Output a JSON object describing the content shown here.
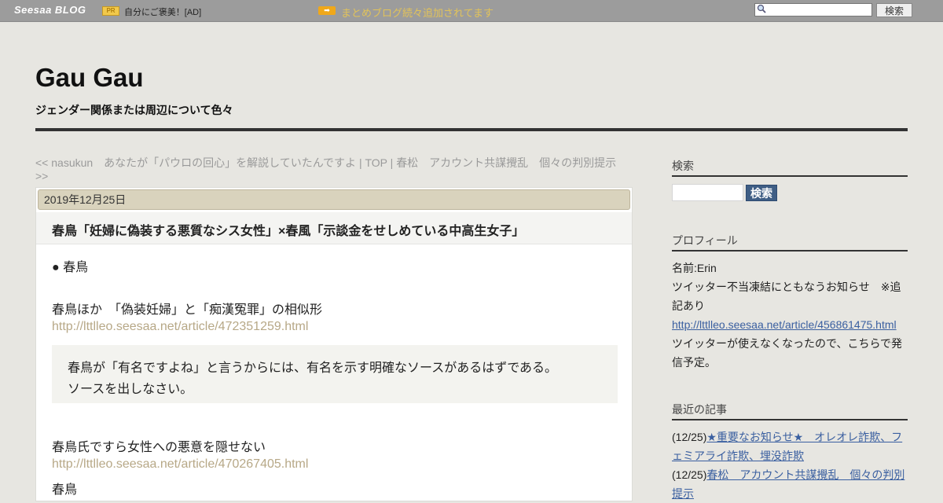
{
  "topbar": {
    "logo": "Seesaa BLOG",
    "pr_badge": "PR",
    "pr_text": "自分にご褒美！[AD]",
    "arrow_badge": "➡",
    "notice": "まとめブログ続々追加されてます",
    "search_button": "検索"
  },
  "header": {
    "title": "Gau Gau",
    "description": "ジェンダー関係または周辺について色々"
  },
  "nav": {
    "prev": "<< nasukun　あなたが「パウロの回心」を解説していたんですよ",
    "sep1": " | ",
    "top": "TOP",
    "sep2": " | ",
    "next": "春松　アカウント共謀攪乱　個々の判別提示",
    "next_arrow": ">>"
  },
  "article": {
    "date": "2019年12月25日",
    "title": "春鳥「妊婦に偽装する悪質なシス女性」×春風「示談金をせしめている中高生女子」",
    "line1": "● 春鳥",
    "line2": "春鳥ほか　「偽装妊婦」と「痴漢冤罪」の相似形",
    "link1": "http://lttlleo.seesaa.net/article/472351259.html",
    "quote1": "春鳥が「有名ですよね」と言うからには、有名を示す明確なソースがあるはずである。",
    "quote2": "ソースを出しなさい。",
    "line3": "春鳥氏ですら女性への悪意を隠せない",
    "link2": "http://lttlleo.seesaa.net/article/470267405.html",
    "line4": "春鳥"
  },
  "sidebar": {
    "search_head": "検索",
    "search_button": "検索",
    "profile_head": "プロフィール",
    "profile_name": "名前:Erin",
    "profile_note_1": "ツイッター不当凍結にともなうお知らせ　※追",
    "profile_note_2": "記あり",
    "profile_link": "http://lttlleo.seesaa.net/article/456861475.html",
    "profile_note_3": "ツイッターが使えなくなったので、こちらで発",
    "profile_note_4": "信予定。",
    "recent_head": "最近の記事",
    "recent": [
      {
        "date": "(12/25)",
        "title_1": "★重要なお知らせ★　オレオレ詐欺、フ",
        "title_2": "ェミアライ詐欺、埋没詐欺"
      },
      {
        "date": "(12/25)",
        "title_1": "春松　アカウント共謀攪乱　個々の判別",
        "title_2": "提示"
      }
    ]
  }
}
